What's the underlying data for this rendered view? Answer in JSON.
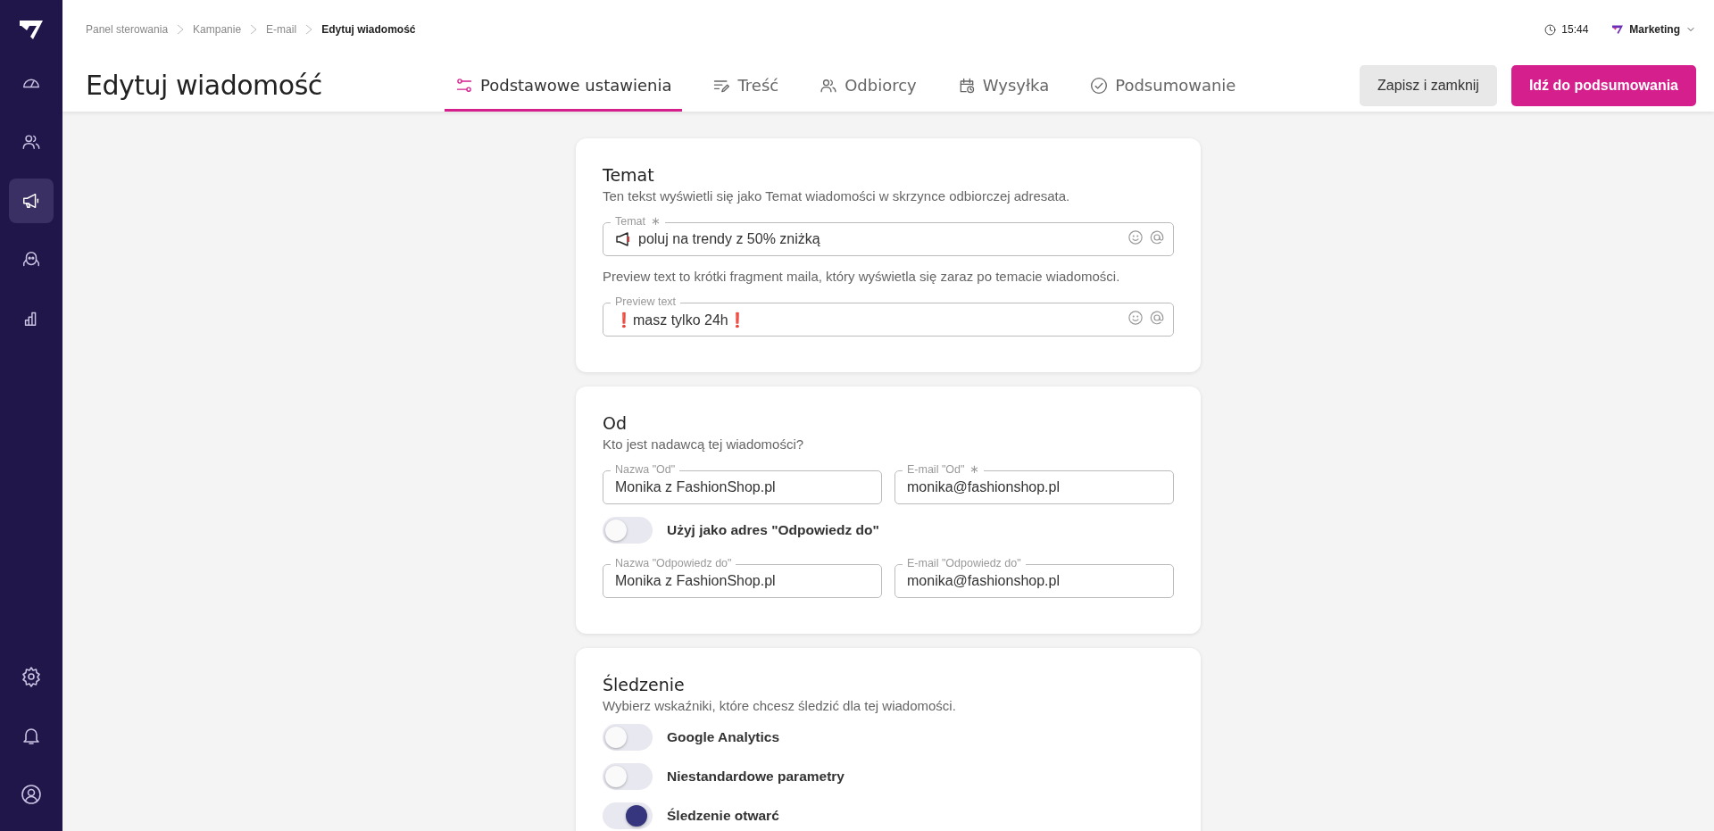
{
  "sidebar": {
    "items": [
      {
        "selected": false
      },
      {
        "selected": false
      },
      {
        "selected": true
      },
      {
        "selected": false
      },
      {
        "selected": false
      }
    ]
  },
  "breadcrumb": [
    "Panel sterowania",
    "Kampanie",
    "E-mail",
    "Edytuj wiadomość"
  ],
  "clock": "15:44",
  "account": "Marketing",
  "title": "Edytuj wiadomość",
  "tabs": [
    {
      "label": "Podstawowe ustawienia",
      "selected": true
    },
    {
      "label": "Treść",
      "selected": false
    },
    {
      "label": "Odbiorcy",
      "selected": false
    },
    {
      "label": "Wysyłka",
      "selected": false
    },
    {
      "label": "Podsumowanie",
      "selected": false
    }
  ],
  "buttons": {
    "secondary": "Zapisz i zamknij",
    "primary": "Idź do podsumowania"
  },
  "sections": [
    {
      "title": "Temat",
      "description": "Ten tekst wyświetli się jako Temat wiadomości w skrzynce odbiorczej adresata.",
      "rows": [
        {
          "kind": "fields",
          "fields": [
            {
              "label": "Temat",
              "required_mark": "∗",
              "has_icon": true,
              "value": "poluj na trendy z 50% zniżką",
              "tools": true
            }
          ]
        },
        {
          "kind": "text",
          "text": "Preview text to krótki fragment maila, który wyświetla się zaraz po temacie wiadomości."
        },
        {
          "kind": "fields",
          "fields": [
            {
              "label": "Preview text",
              "value": "❗masz tylko 24h❗",
              "tools": true
            }
          ]
        }
      ]
    },
    {
      "title": "Od",
      "description": "Kto jest nadawcą tej wiadomości?",
      "rows": [
        {
          "kind": "fields",
          "fields": [
            {
              "label": "Nazwa \"Od\"",
              "value": "Monika z FashionShop.pl"
            },
            {
              "label": "E-mail \"Od\"",
              "required_mark": "∗",
              "value": "monika@fashionshop.pl"
            }
          ]
        },
        {
          "kind": "toggle",
          "label": "Użyj jako adres \"Odpowiedz do\"",
          "checked": false
        },
        {
          "kind": "fields",
          "fields": [
            {
              "label": "Nazwa \"Odpowiedz do\"",
              "value": "Monika z FashionShop.pl"
            },
            {
              "label": "E-mail \"Odpowiedz do\"",
              "value": "monika@fashionshop.pl"
            }
          ]
        }
      ]
    },
    {
      "title": "Śledzenie",
      "description": "Wybierz wskaźniki, które chcesz śledzić dla tej wiadomości.",
      "rows": [
        {
          "kind": "toggle",
          "label": "Google Analytics",
          "checked": false
        },
        {
          "kind": "toggle",
          "label": "Niestandardowe parametry",
          "checked": false
        },
        {
          "kind": "toggle",
          "label": "Śledzenie otwarć",
          "checked": true
        }
      ]
    }
  ]
}
